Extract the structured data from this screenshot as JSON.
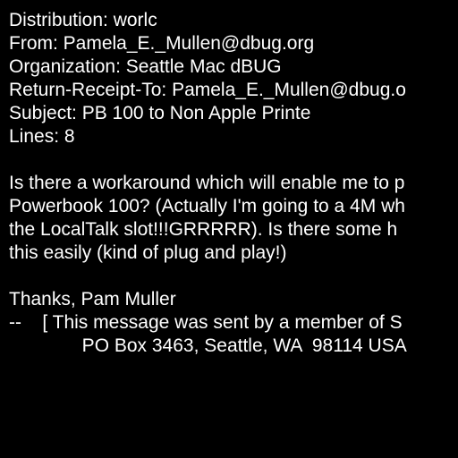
{
  "message": {
    "header": {
      "distribution": "Distribution: worlc",
      "from": "From: Pamela_E._Mullen@dbug.org",
      "organization": "Organization: Seattle Mac dBUG",
      "return_receipt_to": "Return-Receipt-To: Pamela_E._Mullen@dbug.o",
      "subject": "Subject: PB 100 to Non Apple Printe",
      "lines": "Lines: 8"
    },
    "body": {
      "line1": "Is there a workaround which will enable me to p",
      "line2": "Powerbook 100? (Actually I'm going to a 4M wh",
      "line3": "the LocalTalk slot!!!GRRRRR). Is there some h",
      "line4": "this easily (kind of plug and play!)"
    },
    "signature": {
      "thanks": "Thanks, Pam Muller",
      "footer1": "--    [ This message was sent by a member of S",
      "footer2": "              PO Box 3463, Seattle, WA  98114 USA"
    }
  },
  "colors": {
    "background": "#000000",
    "text": "#ffffff"
  }
}
